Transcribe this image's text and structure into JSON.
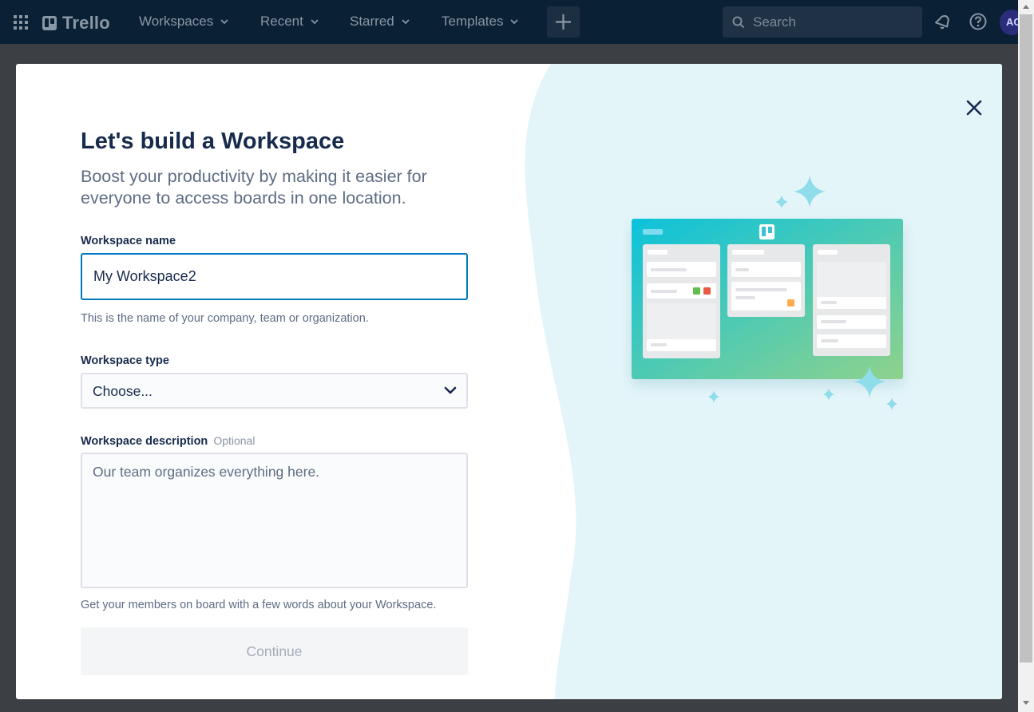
{
  "header": {
    "logo_text": "Trello",
    "nav": [
      {
        "label": "Workspaces"
      },
      {
        "label": "Recent"
      },
      {
        "label": "Starred"
      },
      {
        "label": "Templates"
      }
    ],
    "search_placeholder": "Search",
    "avatar_initials": "AC",
    "icons": [
      "apps-grid-icon",
      "plus-icon",
      "search-icon",
      "notification-bell-icon",
      "help-icon"
    ],
    "bg_color": "#0a2035"
  },
  "modal": {
    "title": "Let's build a Workspace",
    "subtitle": "Boost your productivity by making it easier for everyone to access boards in one location.",
    "workspace_name": {
      "label": "Workspace name",
      "value": "My Workspace2",
      "helper": "This is the name of your company, team or organization."
    },
    "workspace_type": {
      "label": "Workspace type",
      "selected": "Choose..."
    },
    "workspace_description": {
      "label": "Workspace description",
      "optional": "Optional",
      "placeholder": "Our team organizes everything here.",
      "helper": "Get your members on board with a few words about your Workspace."
    },
    "continue_label": "Continue",
    "accent_color": "#0079bf",
    "illustration_bg": "#e4f5f9"
  }
}
